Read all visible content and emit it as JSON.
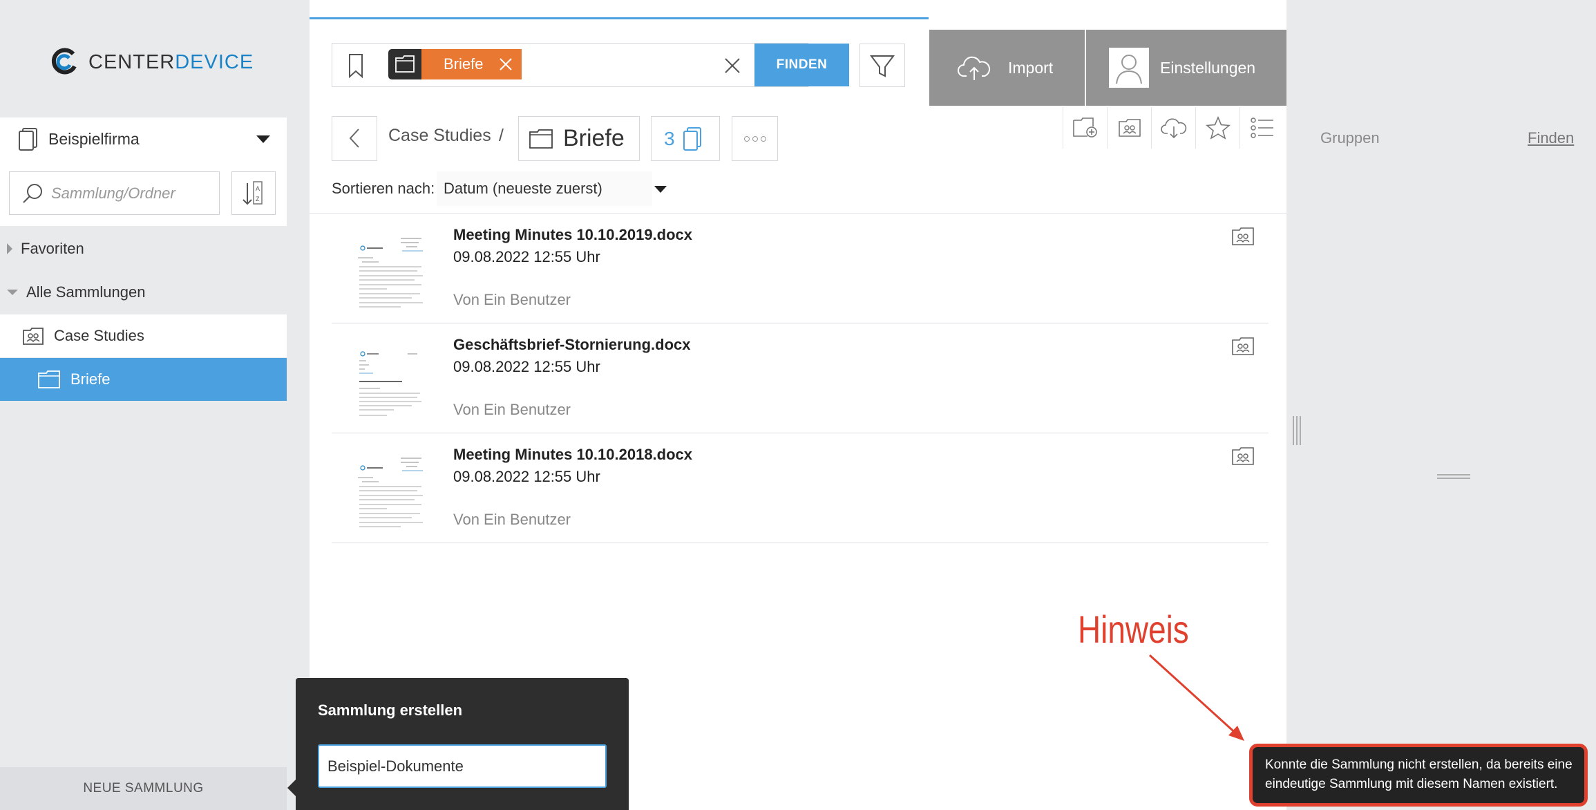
{
  "brand": {
    "prefix": "CENTER",
    "suffix": "DEVICE"
  },
  "sidebar": {
    "company": "Beispielfirma",
    "search_placeholder": "Sammlung/Ordner",
    "tree": {
      "favorites": "Favoriten",
      "all_collections": "Alle Sammlungen",
      "collection": "Case Studies",
      "folder": "Briefe"
    },
    "new_collection": "NEUE SAMMLUNG"
  },
  "search": {
    "chip": "Briefe",
    "find_button": "FINDEN"
  },
  "header": {
    "import": "Import",
    "settings": "Einstellungen"
  },
  "breadcrumb": {
    "parent": "Case Studies",
    "separator": "/",
    "current": "Briefe",
    "count": "3"
  },
  "sort": {
    "label": "Sortieren nach:",
    "value": "Datum (neueste zuerst)"
  },
  "documents": [
    {
      "title": "Meeting Minutes 10.10.2019.docx",
      "date": "09.08.2022 12:55 Uhr",
      "user": "Von Ein Benutzer"
    },
    {
      "title": "Geschäftsbrief-Stornierung.docx",
      "date": "09.08.2022 12:55 Uhr",
      "user": "Von Ein Benutzer"
    },
    {
      "title": "Meeting Minutes 10.10.2018.docx",
      "date": "09.08.2022 12:55 Uhr",
      "user": "Von Ein Benutzer"
    }
  ],
  "right_panel": {
    "groups": "Gruppen",
    "find": "Finden"
  },
  "popover": {
    "title": "Sammlung erstellen",
    "input_value": "Beispiel-Dokumente"
  },
  "annotation": {
    "label": "Hinweis"
  },
  "notice": {
    "text": "Konnte die Sammlung nicht erstellen, da bereits eine eindeutige Sammlung mit diesem Namen existiert."
  },
  "colors": {
    "accent": "#4ba1df",
    "chip": "#e97832",
    "header_buttons": "#939393",
    "annotation": "#e0412e"
  }
}
